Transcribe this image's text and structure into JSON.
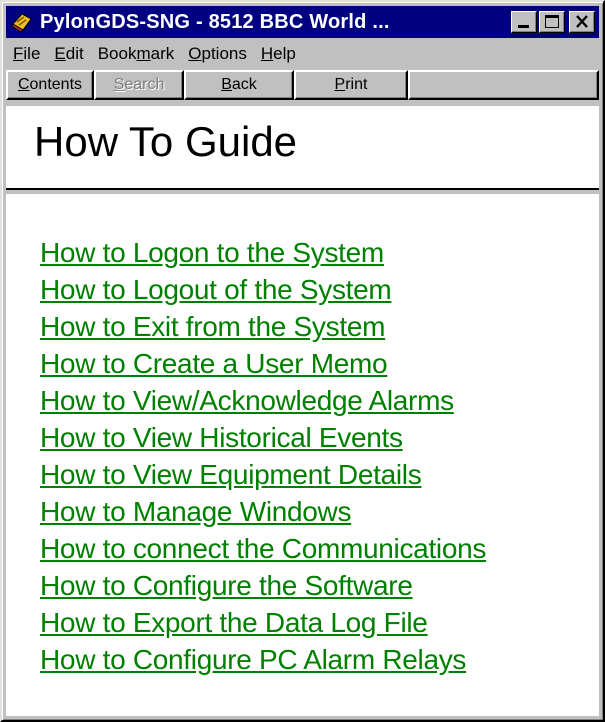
{
  "window": {
    "title": "PylonGDS-SNG - 8512 BBC World ...",
    "controls": [
      "minimize-icon",
      "maximize-icon",
      "close-icon"
    ]
  },
  "menu": [
    {
      "label": "File",
      "mnemonic": "F",
      "rest": "ile"
    },
    {
      "label": "Edit",
      "mnemonic": "E",
      "rest": "dit"
    },
    {
      "label": "Bookmark",
      "pre": "Book",
      "mnemonic": "m",
      "rest": "ark"
    },
    {
      "label": "Options",
      "mnemonic": "O",
      "rest": "ptions"
    },
    {
      "label": "Help",
      "mnemonic": "H",
      "rest": "elp"
    }
  ],
  "toolbar": {
    "contents": {
      "mnemonic": "C",
      "rest": "ontents"
    },
    "search": {
      "mnemonic": "S",
      "rest": "earch",
      "enabled": false
    },
    "back": {
      "mnemonic": "B",
      "rest": "ack"
    },
    "print": {
      "mnemonic": "P",
      "rest": "rint"
    }
  },
  "page": {
    "title": "How To Guide",
    "link_color": "#008000"
  },
  "links": [
    "How to Logon to the System",
    "How to Logout of the System",
    "How to Exit from the System",
    "How to Create a User Memo",
    "How to View/Acknowledge Alarms",
    "How to View Historical Events",
    "How to View Equipment Details",
    "How to Manage Windows",
    "How to connect the Communications",
    "How to Configure the Software",
    "How to Export the Data Log File",
    "How to Configure PC Alarm Relays"
  ]
}
